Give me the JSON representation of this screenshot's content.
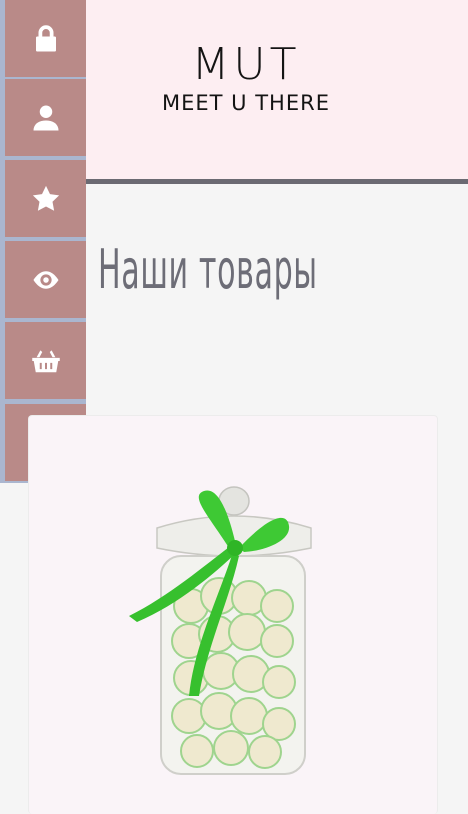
{
  "header": {
    "logo_main": "MUT",
    "logo_sub": "MEET U THERE"
  },
  "sidebar": {
    "items": [
      {
        "icon": "lock-icon",
        "label": ""
      },
      {
        "icon": "user-icon",
        "label": ""
      },
      {
        "icon": "star-icon",
        "label": ""
      },
      {
        "icon": "eye-icon",
        "label": ""
      },
      {
        "icon": "basket-icon",
        "label": ""
      },
      {
        "icon": "paper-plane-icon",
        "label": ""
      }
    ]
  },
  "main": {
    "title": "Наши товары"
  },
  "product": {
    "image": "candy-jar-image"
  },
  "colors": {
    "header_bg": "#fdeef2",
    "sidebar_button": "#b98a88",
    "sidebar_strip": "#aab6cf",
    "title": "#6d6d77",
    "divider": "#6b6a72"
  }
}
